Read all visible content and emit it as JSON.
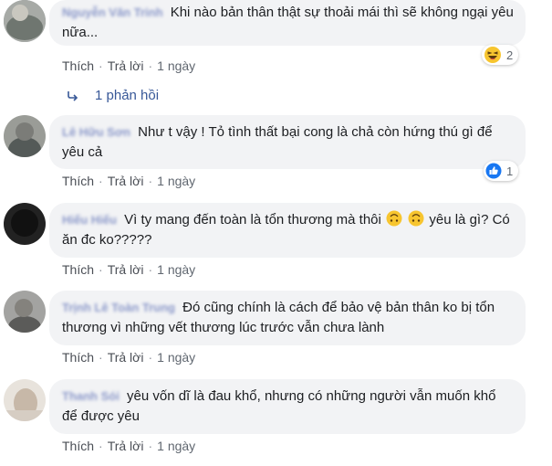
{
  "comments": [
    {
      "author": "Nguyễn Văn Trinh",
      "text": "Khi nào bản thân thật sự thoải mái thì sẽ không ngại yêu nữa...",
      "like": "Thích",
      "reply": "Trả lời",
      "time": "1 ngày",
      "reaction_icon": "laughing-emoji-icon",
      "reaction_count": "2"
    },
    {
      "author": "Lê Hữu Sơn",
      "text": "Như t vậy ! Tỏ tình thất bại cong là chả còn hứng thú gì để yêu cả",
      "like": "Thích",
      "reply": "Trả lời",
      "time": "1 ngày",
      "reaction_icon": "like-thumb-icon",
      "reaction_count": "1"
    },
    {
      "author": "Hiếu Hiếu",
      "text_before": "Vì ty mang đến toàn là tổn thương mà thôi",
      "text_after": "yêu là gì? Có ăn đc ko?????",
      "like": "Thích",
      "reply": "Trả lời",
      "time": "1 ngày"
    },
    {
      "author": "Trịnh Lê Toàn Trung",
      "text": "Đó cũng chính là cách để bảo vệ bản thân ko bị tổn thương vì những vết thương lúc trước vẫn chưa lành",
      "like": "Thích",
      "reply": "Trả lời",
      "time": "1 ngày"
    },
    {
      "author": "Thanh Sói",
      "text": "yêu vốn dĩ là đau khổ, nhưng có những người vẫn muốn khổ để được yêu",
      "like": "Thích",
      "reply": "Trả lời",
      "time": "1 ngày"
    }
  ],
  "replies_link": "1 phản hồi",
  "colors": {
    "bubble": "#f2f3f5",
    "link": "#385898",
    "meta": "#606770",
    "author_blurred": "#8b98c9",
    "like_blue": "#1877f2"
  }
}
